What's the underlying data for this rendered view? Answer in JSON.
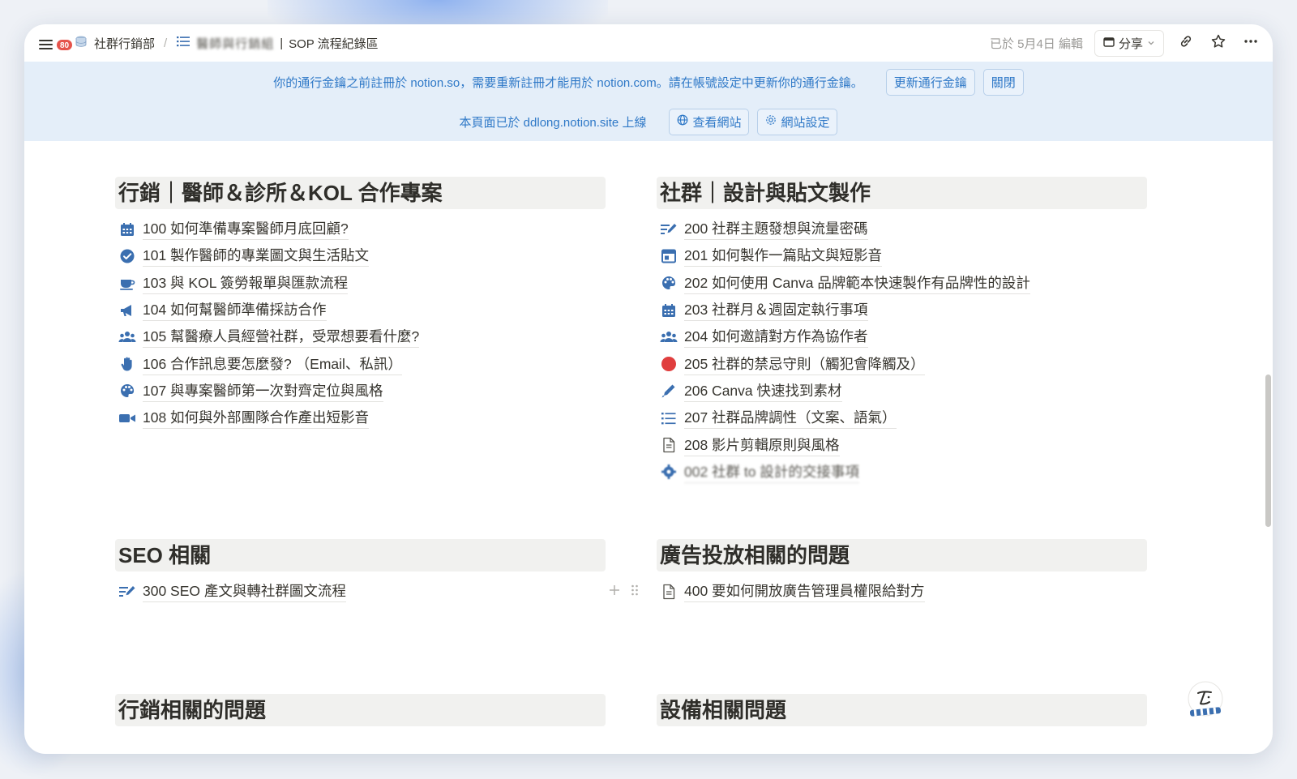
{
  "topbar": {
    "notification_count": "80",
    "breadcrumb": [
      {
        "label": "社群行銷部",
        "icon": "database-icon"
      },
      {
        "label": "醫師與行銷組",
        "icon": "list-icon"
      },
      {
        "label": "SOP 流程紀錄區"
      }
    ],
    "separator": "/",
    "title_divider": "|",
    "edited_label": "已於 5月4日 編輯",
    "share_label": "分享"
  },
  "banner": {
    "message": "你的通行金鑰之前註冊於 notion.so，需要重新註冊才能用於 notion.com。請在帳號設定中更新你的通行金鑰。",
    "update_button": "更新通行金鑰",
    "close_button": "關閉",
    "site_message": "本頁面已於 ddlong.notion.site 上線",
    "view_site_button": "查看網站",
    "site_settings_button": "網站設定"
  },
  "sections": [
    {
      "title": "行銷｜醫師＆診所＆KOL 合作專案",
      "items": [
        {
          "label": "100 如何準備專案醫師月底回顧?",
          "icon": "calendar-icon"
        },
        {
          "label": "101 製作醫師的專業圖文與生活貼文",
          "icon": "check-circle-icon"
        },
        {
          "label": "103 與 KOL 簽勞報單與匯款流程",
          "icon": "coffee-cup-icon"
        },
        {
          "label": "104 如何幫醫師準備採訪合作",
          "icon": "megaphone-icon"
        },
        {
          "label": "105 幫醫療人員經營社群，受眾想要看什麼?",
          "icon": "people-icon"
        },
        {
          "label": "106 合作訊息要怎麼發? （Email、私訊）",
          "icon": "hand-icon"
        },
        {
          "label": "107 與專案醫師第一次對齊定位與風格",
          "icon": "palette-icon"
        },
        {
          "label": "108 如何與外部團隊合作產出短影音",
          "icon": "video-camera-icon"
        }
      ]
    },
    {
      "title": "社群｜設計與貼文製作",
      "items": [
        {
          "label": "200 社群主題發想與流量密碼",
          "icon": "write-list-icon"
        },
        {
          "label": "201 如何製作一篇貼文與短影音",
          "icon": "layout-icon"
        },
        {
          "label": "202 如何使用 Canva 品牌範本快速製作有品牌性的設計",
          "icon": "palette-icon"
        },
        {
          "label": "203 社群月＆週固定執行事項",
          "icon": "calendar-icon"
        },
        {
          "label": "204 如何邀請對方作為協作者",
          "icon": "people-icon"
        },
        {
          "label": "205 社群的禁忌守則（觸犯會降觸及）",
          "icon": "red-circle-icon"
        },
        {
          "label": "206 Canva 快速找到素材",
          "icon": "pen-icon"
        },
        {
          "label": "207 社群品牌調性（文案、語氣）",
          "icon": "bullet-list-icon"
        },
        {
          "label": "208 影片剪輯原則與風格",
          "icon": "document-icon"
        },
        {
          "label": "002 社群 to 設計的交接事項",
          "icon": "gear-icon"
        }
      ]
    },
    {
      "title": "SEO 相關",
      "items": [
        {
          "label": "300 SEO 產文與轉社群圖文流程",
          "icon": "write-list-icon"
        }
      ]
    },
    {
      "title": "廣告投放相關的問題",
      "items": [
        {
          "label": "400 要如何開放廣告管理員權限給對方",
          "icon": "document-icon"
        }
      ]
    },
    {
      "title": "行銷相關的問題",
      "items": []
    },
    {
      "title": "設備相關問題",
      "items": []
    }
  ],
  "colors": {
    "accent_blue": "#2e78c7",
    "banner_bg": "#e4eef9",
    "icon_blue": "#3b6fb0",
    "badge_red": "#e5534b",
    "danger_red": "#e03e3e"
  }
}
